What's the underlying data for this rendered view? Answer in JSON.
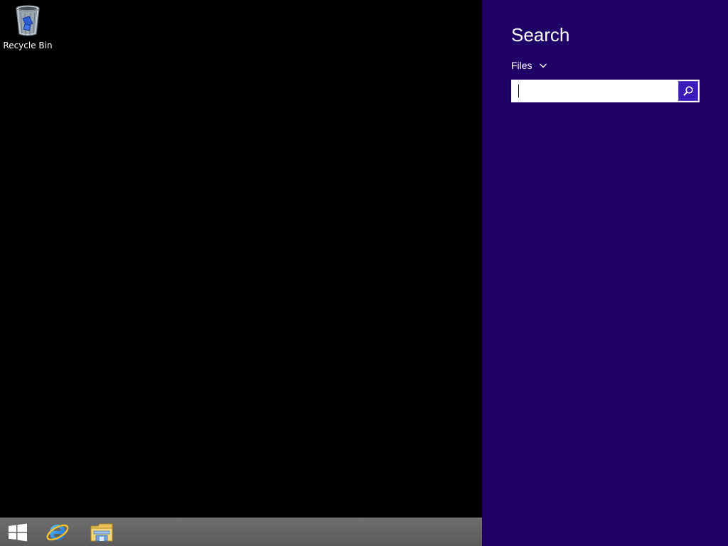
{
  "desktop": {
    "icons": [
      {
        "label": "Recycle Bin",
        "icon": "recycle-bin-icon"
      }
    ]
  },
  "taskbar": {
    "buttons": [
      {
        "icon": "windows-start-icon"
      },
      {
        "icon": "internet-explorer-icon"
      },
      {
        "icon": "file-explorer-icon"
      }
    ]
  },
  "search_pane": {
    "title": "Search",
    "scope": "Files",
    "input_value": "",
    "search_button_icon": "search-icon"
  },
  "colors": {
    "desktop_background": "#000000",
    "charm_background": "#1e0067",
    "search_button": "#3a1bb8",
    "taskbar": "#666666"
  }
}
